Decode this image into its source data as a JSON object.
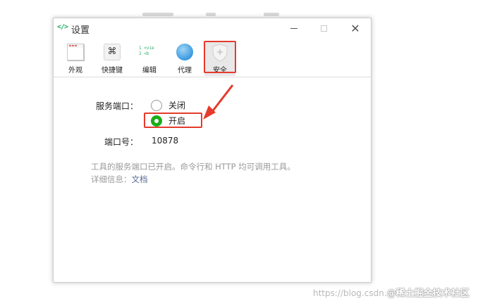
{
  "window": {
    "title": "设置",
    "app_icon": "</>"
  },
  "toolbar": {
    "items": [
      {
        "label": "外观",
        "icon": "appearance-icon"
      },
      {
        "label": "快捷键",
        "icon": "shortcut-icon",
        "glyph": "⌘"
      },
      {
        "label": "编辑",
        "icon": "editor-icon",
        "glyph_lines": [
          "1 <vie",
          "2  <b"
        ]
      },
      {
        "label": "代理",
        "icon": "globe-icon"
      },
      {
        "label": "安全",
        "icon": "shield-icon",
        "active": true
      }
    ]
  },
  "security": {
    "service_port_label": "服务端口：",
    "options": [
      {
        "label": "关闭",
        "selected": false
      },
      {
        "label": "开启",
        "selected": true
      }
    ],
    "port_label": "端口号：",
    "port_value": "10878",
    "description": "工具的服务端口已开启。命令行和 HTTP 均可调用工具。详细信息：",
    "doc_link": "文档"
  },
  "colors": {
    "accent_green": "#1aad19",
    "annotation_red": "#e53b2c",
    "link": "#576b95"
  },
  "watermark": {
    "text": "https://blog.csdn.",
    "brand": "@稀土掘金技术社区"
  }
}
